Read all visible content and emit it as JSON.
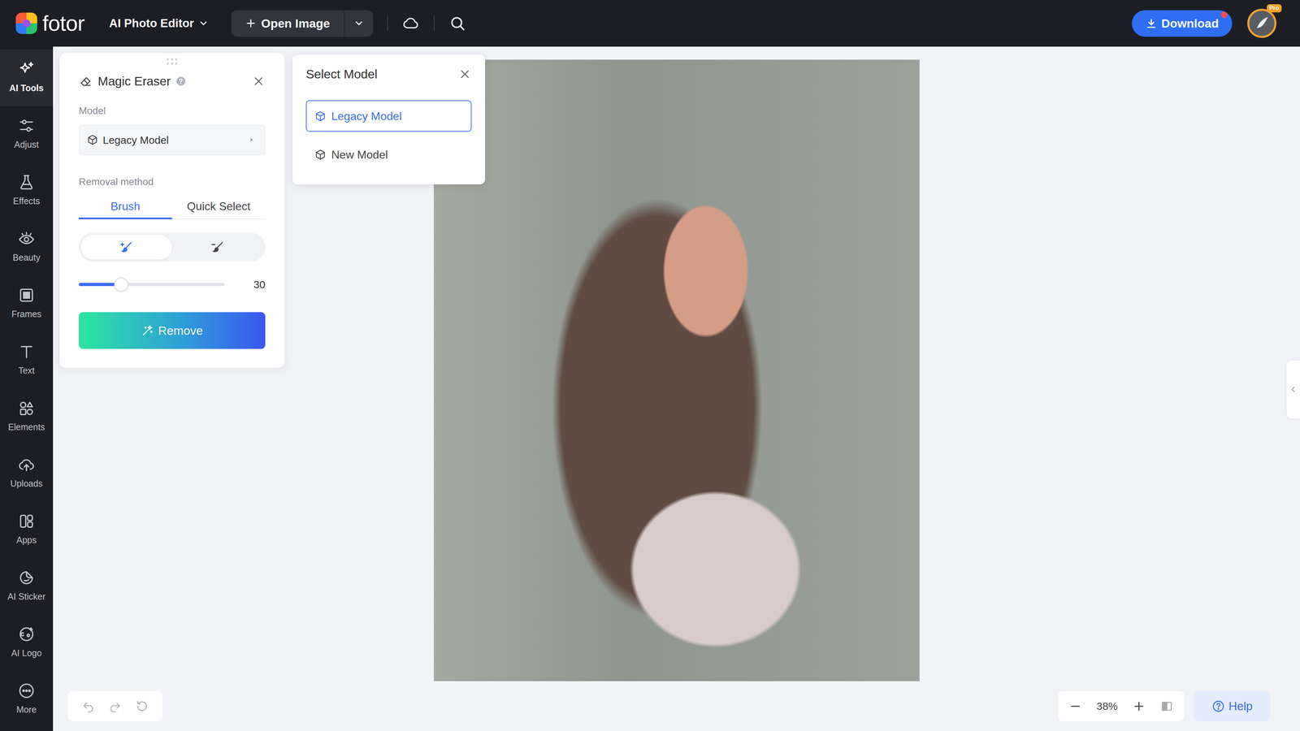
{
  "app": {
    "logo": "fotor",
    "mode": "AI Photo Editor"
  },
  "toolbar": {
    "open_image": "Open Image",
    "download": "Download",
    "notification": true,
    "account_badge": "Pro"
  },
  "sidebar": {
    "items": [
      {
        "label": "AI Tools",
        "selected": true
      },
      {
        "label": "Adjust",
        "selected": false
      },
      {
        "label": "Effects",
        "selected": false
      },
      {
        "label": "Beauty",
        "selected": false
      },
      {
        "label": "Frames",
        "selected": false
      },
      {
        "label": "Text",
        "selected": false
      },
      {
        "label": "Elements",
        "selected": false
      },
      {
        "label": "Uploads",
        "selected": false
      },
      {
        "label": "Apps",
        "selected": false
      },
      {
        "label": "AI Sticker",
        "selected": false
      },
      {
        "label": "AI Logo",
        "selected": false
      },
      {
        "label": "More",
        "selected": false
      }
    ]
  },
  "magic_eraser": {
    "title": "Magic Eraser",
    "model_label": "Model",
    "model": "Legacy Model",
    "removal_label": "Removal method",
    "tabs": [
      {
        "label": "Brush",
        "selected": true
      },
      {
        "label": "Quick Select",
        "selected": false
      }
    ],
    "brush_modes": [
      {
        "kind": "add",
        "selected": true
      },
      {
        "kind": "erase",
        "selected": false
      }
    ],
    "brush_size": {
      "level": 0.29,
      "reading": "30"
    },
    "remove": "Remove"
  },
  "model_menu": {
    "title": "Select Model",
    "options": [
      {
        "label": "Legacy Model",
        "selected": true
      },
      {
        "label": "New Model",
        "selected": false
      }
    ]
  },
  "history": [
    {
      "kind": "undo",
      "disabled": true
    },
    {
      "kind": "redo",
      "disabled": true
    },
    {
      "kind": "reset",
      "disabled": true
    }
  ],
  "zoom": {
    "reading": "38%"
  },
  "help": "Help"
}
